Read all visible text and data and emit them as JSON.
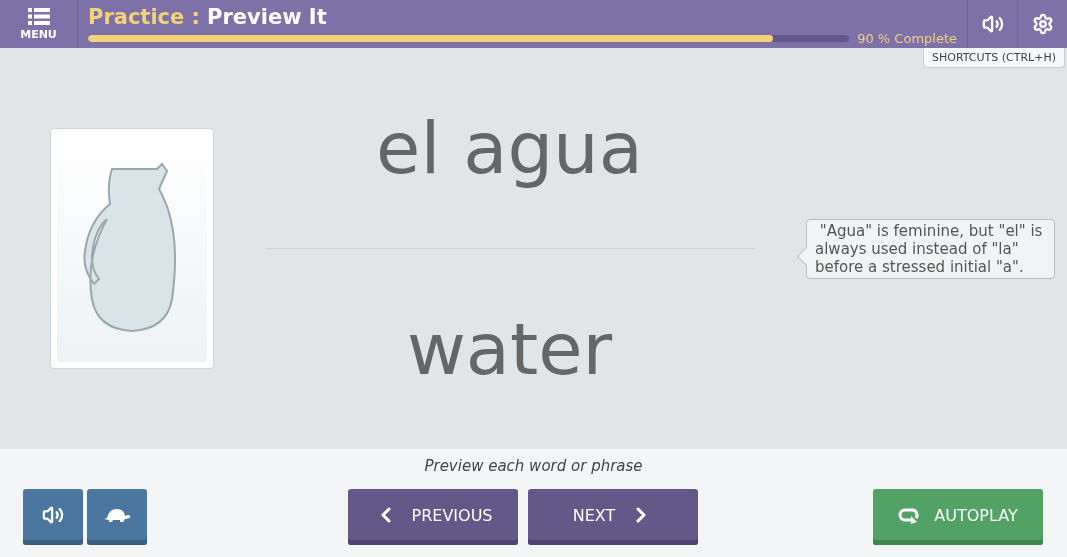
{
  "header": {
    "menu_label": "MENU",
    "section": "Practice :",
    "page": "Preview It",
    "progress": {
      "level": 0.9,
      "label": "90 % Complete"
    }
  },
  "shortcuts_tooltip": "SHORTCUTS (CTRL+H)",
  "card": {
    "word": "el agua",
    "translation": "water",
    "note": " \"Agua\" is feminine, but \"el\" is always used instead of \"la\" before a stressed initial \"a\"."
  },
  "caption": "Preview each word or phrase",
  "buttons": [
    {
      "kind": "audio"
    },
    {
      "kind": "slow"
    },
    {
      "kind": "previous",
      "label": "PREVIOUS"
    },
    {
      "kind": "next",
      "label": "NEXT"
    },
    {
      "kind": "autoplay",
      "label": "AUTOPLAY"
    }
  ]
}
